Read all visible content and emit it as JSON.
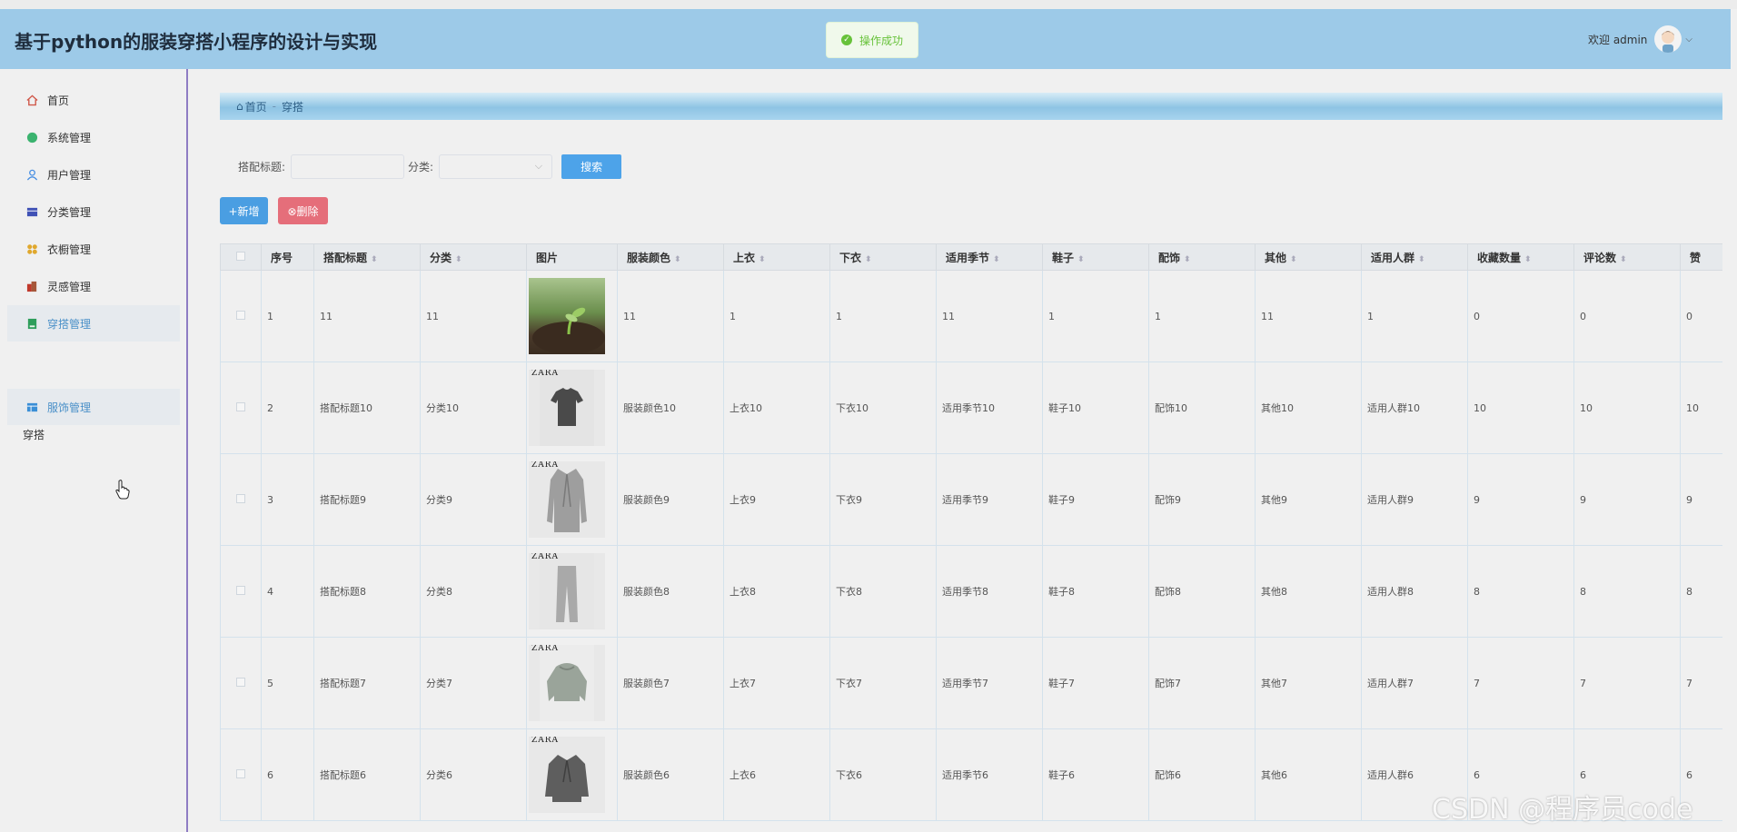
{
  "header": {
    "title": "基于python的服装穿搭小程序的设计与实现",
    "toast": "操作成功",
    "welcome": "欢迎 admin"
  },
  "sidebar": {
    "items": [
      {
        "label": "首页",
        "icon": "home-icon"
      },
      {
        "label": "系统管理",
        "icon": "dot-icon"
      },
      {
        "label": "用户管理",
        "icon": "user-icon"
      },
      {
        "label": "分类管理",
        "icon": "box-icon"
      },
      {
        "label": "衣橱管理",
        "icon": "grid-icon"
      },
      {
        "label": "灵感管理",
        "icon": "building-icon"
      },
      {
        "label": "穿搭管理",
        "icon": "book-icon"
      }
    ],
    "group_label": "穿搭",
    "sub_items": [
      {
        "label": "服饰管理",
        "icon": "table-icon"
      }
    ]
  },
  "breadcrumb": {
    "home": "首页",
    "current": "穿搭"
  },
  "search": {
    "title_label": "搭配标题:",
    "category_label": "分类:",
    "button": "搜索"
  },
  "actions": {
    "add": "+新增",
    "delete": "⊗删除"
  },
  "table": {
    "headers": [
      "序号",
      "搭配标题",
      "分类",
      "图片",
      "服装颜色",
      "上衣",
      "下衣",
      "适用季节",
      "鞋子",
      "配饰",
      "其他",
      "适用人群",
      "收藏数量",
      "评论数",
      "赞"
    ],
    "rows": [
      {
        "no": "1",
        "title": "11",
        "category": "11",
        "image": "seedling-photo",
        "color": "11",
        "top": "1",
        "bottom": "1",
        "season": "11",
        "shoes": "1",
        "accessory": "1",
        "other": "11",
        "crowd": "1",
        "favorites": "0",
        "comments": "0",
        "likes": "0"
      },
      {
        "no": "2",
        "title": "搭配标题10",
        "category": "分类10",
        "image": "tshirt",
        "color": "服装颜色10",
        "top": "上衣10",
        "bottom": "下衣10",
        "season": "适用季节10",
        "shoes": "鞋子10",
        "accessory": "配饰10",
        "other": "其他10",
        "crowd": "适用人群10",
        "favorites": "10",
        "comments": "10",
        "likes": "10"
      },
      {
        "no": "3",
        "title": "搭配标题9",
        "category": "分类9",
        "image": "coat",
        "color": "服装颜色9",
        "top": "上衣9",
        "bottom": "下衣9",
        "season": "适用季节9",
        "shoes": "鞋子9",
        "accessory": "配饰9",
        "other": "其他9",
        "crowd": "适用人群9",
        "favorites": "9",
        "comments": "9",
        "likes": "9"
      },
      {
        "no": "4",
        "title": "搭配标题8",
        "category": "分类8",
        "image": "pants",
        "color": "服装颜色8",
        "top": "上衣8",
        "bottom": "下衣8",
        "season": "适用季节8",
        "shoes": "鞋子8",
        "accessory": "配饰8",
        "other": "其他8",
        "crowd": "适用人群8",
        "favorites": "8",
        "comments": "8",
        "likes": "8"
      },
      {
        "no": "5",
        "title": "搭配标题7",
        "category": "分类7",
        "image": "jacket",
        "color": "服装颜色7",
        "top": "上衣7",
        "bottom": "下衣7",
        "season": "适用季节7",
        "shoes": "鞋子7",
        "accessory": "配饰7",
        "other": "其他7",
        "crowd": "适用人群7",
        "favorites": "7",
        "comments": "7",
        "likes": "7"
      },
      {
        "no": "6",
        "title": "搭配标题6",
        "category": "分类6",
        "image": "blazer",
        "color": "服装颜色6",
        "top": "上衣6",
        "bottom": "下衣6",
        "season": "适用季节6",
        "shoes": "鞋子6",
        "accessory": "配饰6",
        "other": "其他6",
        "crowd": "适用人群6",
        "favorites": "6",
        "comments": "6",
        "likes": "6"
      }
    ],
    "zara_mark": "ZARA"
  },
  "watermark": "CSDN @程序员code",
  "colors": {
    "header": "#9dcae8",
    "accent": "#4a9ee2",
    "danger": "#e56e7a",
    "success": "#67c23a"
  }
}
